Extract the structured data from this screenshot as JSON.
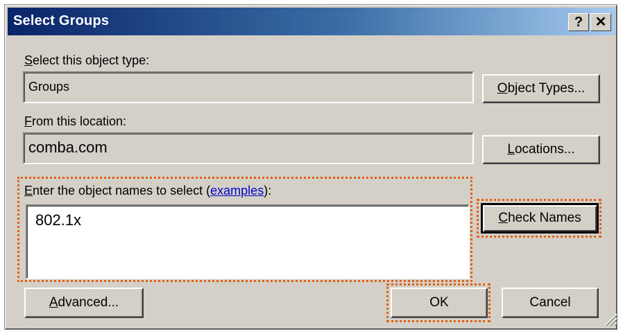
{
  "dialog": {
    "title": "Select Groups",
    "help_glyph": "?",
    "close_glyph": "✕"
  },
  "object_type": {
    "label_mnemonic": "S",
    "label_rest": "elect this object type:",
    "value": "Groups",
    "button_mnemonic": "O",
    "button_rest": "bject Types..."
  },
  "location": {
    "label_mnemonic": "F",
    "label_rest": "rom this location:",
    "value": "comba.com",
    "button_mnemonic": "L",
    "button_rest": "ocations..."
  },
  "names": {
    "label_mnemonic": "E",
    "label_rest": "nter the object names to select (",
    "examples_link": "examples",
    "label_end": "):",
    "value": "802.1x",
    "check_mnemonic": "C",
    "check_rest": "heck Names"
  },
  "footer": {
    "advanced_mnemonic": "A",
    "advanced_rest": "dvanced...",
    "ok_label": "OK",
    "cancel_label": "Cancel"
  },
  "colors": {
    "title_gradient_start": "#0a246a",
    "title_gradient_end": "#a6caf0",
    "dialog_face": "#d4d0c8",
    "highlight_dots": "#e06010",
    "link": "#0000cc"
  }
}
